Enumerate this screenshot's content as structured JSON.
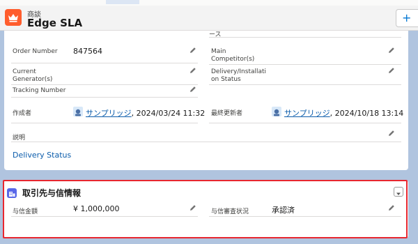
{
  "header": {
    "object_type": "商談",
    "title": "Edge SLA",
    "new_button_label": "+ ",
    "icon": "crown-icon"
  },
  "fields": {
    "truncated_tail": "ース",
    "order_number_label": "Order Number",
    "order_number_value": "847564",
    "main_competitor_label_1": "Main",
    "main_competitor_label_2": "Competitor(s)",
    "current_generator_label_1": "Current",
    "current_generator_label_2": "Generator(s)",
    "delivery_status_label_1": "Delivery/Installati",
    "delivery_status_label_2": "on Status",
    "tracking_number_label": "Tracking Number",
    "created_by_label": "作成者",
    "created_by_user": "サンプリッジ",
    "created_by_date": ", 2024/03/24 11:32",
    "modified_by_label": "最終更新者",
    "modified_by_user": "サンプリッジ",
    "modified_by_date": ", 2024/10/18 13:14",
    "description_label": "説明",
    "delivery_status_link": "Delivery Status"
  },
  "credit_section": {
    "title": "取引先与信情報",
    "credit_amount_label": "与信金額",
    "credit_amount_value": "¥ 1,000,000",
    "credit_review_label": "与信審査状況",
    "credit_review_value": "承認済"
  },
  "colors": {
    "header_icon": "#ff5d2d",
    "section_icon": "#5867e8",
    "highlight": "#e8272f",
    "link": "#0b5cab"
  }
}
